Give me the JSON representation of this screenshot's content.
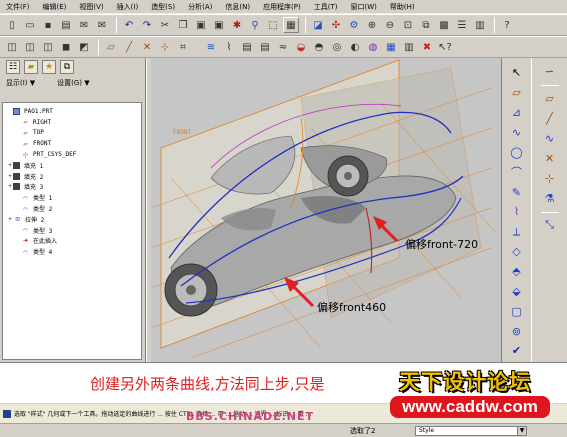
{
  "menubar": {
    "items": [
      "文件(F)",
      "编辑(E)",
      "视图(V)",
      "插入(I)",
      "造型(S)",
      "分析(A)",
      "信息(N)",
      "应用程序(P)",
      "工具(T)",
      "窗口(W)",
      "帮助(H)"
    ]
  },
  "panel": {
    "show_label": "显示(I) ▼",
    "settings_label": "设置(G) ▼"
  },
  "tree": {
    "items": [
      {
        "label": "PAO1.PRT",
        "icon": "part-icon",
        "expand": "",
        "indent": 0
      },
      {
        "label": "RIGHT",
        "icon": "datum-plane-icon",
        "expand": "",
        "indent": 1
      },
      {
        "label": "TOP",
        "icon": "datum-plane-icon",
        "expand": "",
        "indent": 1
      },
      {
        "label": "FRONT",
        "icon": "datum-plane-icon",
        "expand": "",
        "indent": 1
      },
      {
        "label": "PRT_CSYS_DEF",
        "icon": "csys-icon",
        "expand": "",
        "indent": 1
      },
      {
        "label": "填充 1",
        "icon": "fill-icon",
        "expand": "+",
        "indent": 0
      },
      {
        "label": "填充 2",
        "icon": "fill-icon",
        "expand": "+",
        "indent": 0
      },
      {
        "label": "填充 3",
        "icon": "fill-icon",
        "expand": "+",
        "indent": 0
      },
      {
        "label": "类型 1",
        "icon": "style-curve-icon",
        "expand": "",
        "indent": 1
      },
      {
        "label": "类型 2",
        "icon": "style-curve-icon",
        "expand": "",
        "indent": 1
      },
      {
        "label": "拉伸 2",
        "icon": "extrude-icon",
        "expand": "+",
        "indent": 0
      },
      {
        "label": "类型 3",
        "icon": "style-curve-icon",
        "expand": "",
        "indent": 1
      },
      {
        "label": "在此插入",
        "icon": "insert-here-icon",
        "expand": "",
        "indent": 1
      },
      {
        "label": "类型 4",
        "icon": "style-curve-icon",
        "expand": "",
        "indent": 1
      }
    ]
  },
  "viewport": {
    "front_label": "FRONT",
    "annotation_720": "偏移front-720",
    "annotation_460": "偏移front460"
  },
  "message": {
    "caption": "创建另外两条曲线,方法同上步,只是"
  },
  "logo": {
    "title": "天下设计论坛",
    "url": "www.caddw.com"
  },
  "status": {
    "text": "选取 \"样式\" 几何或下一个工具。拖动选定的曲线进行 ... 按住 CTRL 选择 ... 可 ... 拖动 ... 边界 ... 标识 ... 重 ...",
    "bbs": "BBS.CHINADE.NET",
    "selected": "选取了2",
    "style_value": "Style"
  },
  "colors": {
    "chrome": "#d4d0c8",
    "viewport_bg": "#c6c6c6",
    "annotation_red": "#e02020",
    "curve_blue": "#2030c0",
    "curve_orange": "#e08020"
  }
}
